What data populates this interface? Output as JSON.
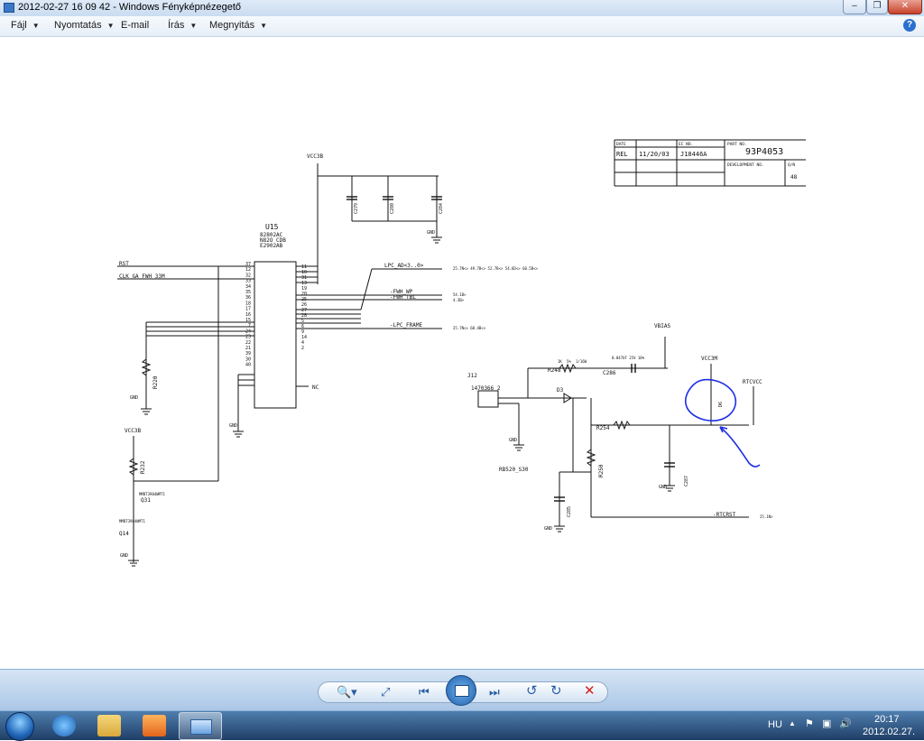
{
  "window": {
    "title": "2012-02-27 16 09 42 - Windows Fényképnézegető",
    "minimize_glyph": "–",
    "maximize_glyph": "❐",
    "close_glyph": "✕"
  },
  "menu": [
    {
      "label": "Fájl"
    },
    {
      "label": "Nyomtatás"
    },
    {
      "label": "E-mail"
    },
    {
      "label": "Írás"
    },
    {
      "label": "Megnyitás"
    }
  ],
  "menu_caret": "▼",
  "help_glyph": "?",
  "schematic": {
    "title_block": {
      "rel": "REL",
      "date_header": "DATE",
      "date": "11/20/03",
      "ec_header": "EC NO.",
      "ec_no": "J18446A",
      "part_header": "PART NO.",
      "part_no": "93P4053",
      "dev_header": "DEVELOPMENT NO.",
      "sheet_header": "Q/N",
      "sheet": "48"
    },
    "labels": {
      "vcc3b_top": "VCC3B",
      "chip_ref": "U15",
      "chip_name1": "82802AC",
      "chip_name2": "N82O CDB",
      "chip_name3": "E2902AB",
      "rst": "RST",
      "clk": "CLK_GA_FWH_33M",
      "lpc_ad": "LPC_AD<3..0>",
      "lpc_ad_refs": "25.7N<> 49.7B<> 52.7B<> 54.6D<> 60.5B<>",
      "fwh_wp": "-FWH_WP",
      "fwh_wp_ref": "54.1B>",
      "fwh_tbl": "-FWH_TBL",
      "fwh_tbl_ref": "4.3B>",
      "lpc_frame": "-LPC_FRAME",
      "lpc_frame_ref": "25.7N<> 60.4B<>",
      "gnd": "GND",
      "r220": "R220",
      "vcc3b_left": "VCC3B",
      "r232": "R232",
      "q31": "Q31",
      "q14": "Q14",
      "q_part1": "MMBT3904WMT1",
      "q_part2": "MMBT3904WMT1",
      "nc": "NC",
      "c279": "C279",
      "c280": "C280",
      "c284": "C284",
      "vbias": "VBIAS",
      "r248": "R248",
      "c286": "C286",
      "j12": "J12",
      "j12_part": "1470366_2",
      "d3": "D3",
      "rb520": "RB520_S30",
      "r254": "R254",
      "r250": "R250",
      "c285": "C285",
      "c287": "C287",
      "vcc3m": "VCC3M",
      "rtcvcc": "RTCVCC",
      "d6": "D6",
      "rtcrst": "-RTCRST",
      "rtcrst_ref": "25.1N>",
      "r_1k": "1K",
      "r_5pct": "5%",
      "r_1_16w": "1/16W",
      "cap_val": "0.047UF 25V 10%"
    },
    "pins_left": [
      "37",
      "12",
      "32",
      "33",
      "34",
      "35",
      "36",
      "18",
      "17",
      "16",
      "15",
      "7",
      "24",
      "23",
      "22",
      "21",
      "39",
      "30",
      "40"
    ],
    "pins_right": [
      "11",
      "10",
      "31",
      "13",
      "19",
      "20",
      "25",
      "26",
      "27",
      "28",
      "5",
      "6",
      "9",
      "14",
      "4",
      "2"
    ]
  },
  "controls": {
    "zoom_glyph": "🔍▾",
    "fit_glyph": "⤢",
    "prev_glyph": "⏮",
    "next_glyph": "⏭",
    "rotate_ccw_glyph": "↺",
    "rotate_cw_glyph": "↻",
    "delete_glyph": "✕"
  },
  "taskbar": {
    "lang": "HU",
    "time": "20:17",
    "date": "2012.02.27."
  },
  "colors": {
    "annotation": "#1f2ee6",
    "taskbar": "#2a4f7e"
  }
}
